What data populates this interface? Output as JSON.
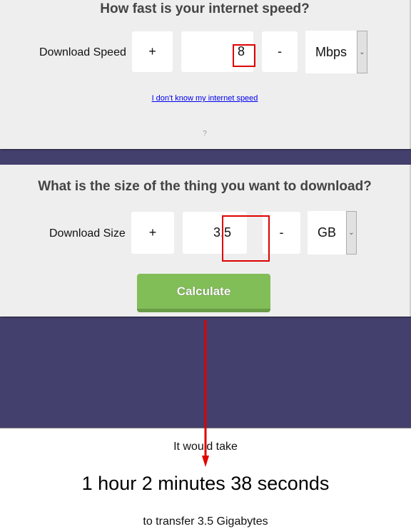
{
  "speed_section": {
    "title": "How fast is your internet speed?",
    "label": "Download Speed",
    "plus_label": "+",
    "value": "8",
    "minus_label": "-",
    "unit": "Mbps",
    "help_link": "I don't know my internet speed",
    "help_mark": "?"
  },
  "size_section": {
    "title": "What is the size of the thing you want to download?",
    "label": "Download Size",
    "plus_label": "+",
    "value": "3.5",
    "minus_label": "-",
    "unit": "GB",
    "calculate_label": "Calculate"
  },
  "result": {
    "intro": "It would take",
    "duration": "1 hour 2 minutes 38 seconds",
    "detail": "to transfer 3.5 Gigabytes"
  },
  "icons": {
    "dropdown": "chevron-down-icon",
    "annotation": "arrow-down-icon"
  },
  "colors": {
    "background": "#43406d",
    "card": "#eeeeee",
    "button": "#82be57",
    "highlight": "#e00000",
    "link": "#0000ee"
  }
}
